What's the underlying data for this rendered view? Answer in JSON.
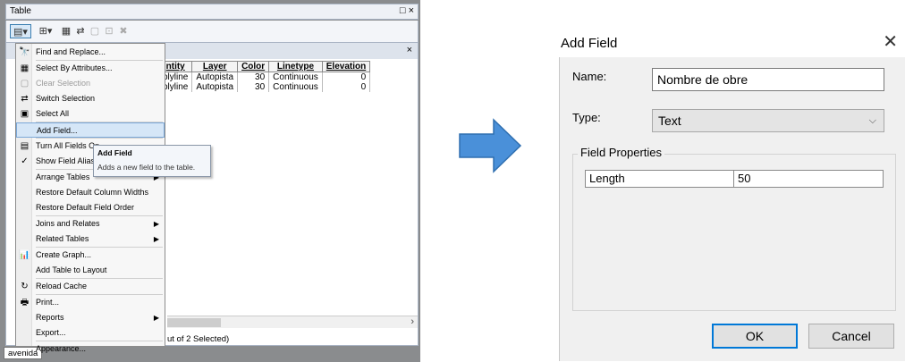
{
  "table_window": {
    "title": "Table",
    "window_buttons": "□ ×",
    "inner_close": "×",
    "columns": [
      "ntity",
      "Layer",
      "Color",
      "Linetype",
      "Elevation"
    ],
    "rows": [
      [
        "olyline",
        "Autopista",
        "30",
        "Continuous",
        "0"
      ],
      [
        "olyline",
        "Autopista",
        "30",
        "Continuous",
        "0"
      ]
    ],
    "status_text": "ut of 2 Selected)",
    "bottom_tab": "avenida",
    "scroll_right_arrow": "›"
  },
  "context_menu": {
    "items": [
      {
        "label": "Find and Replace...",
        "icon": "binoculars-icon",
        "glyph": "🔭"
      },
      {
        "label": "Select By Attributes...",
        "icon": "select-attributes-icon",
        "glyph": "▦"
      },
      {
        "label": "Clear Selection",
        "icon": "clear-selection-icon",
        "glyph": "▢",
        "disabled": true
      },
      {
        "label": "Switch Selection",
        "icon": "switch-selection-icon",
        "glyph": "⇄"
      },
      {
        "label": "Select All",
        "icon": "select-all-icon",
        "glyph": "▣"
      },
      {
        "label": "Add Field...",
        "icon": "",
        "glyph": "",
        "highlight": true
      },
      {
        "label": "Turn All Fields On",
        "icon": "fields-icon",
        "glyph": "▤"
      },
      {
        "label": "Show Field Aliases",
        "icon": "check-icon",
        "glyph": "✓"
      },
      {
        "label": "Arrange Tables",
        "icon": "",
        "glyph": "",
        "submenu": true
      },
      {
        "label": "Restore Default Column Widths",
        "icon": "",
        "glyph": ""
      },
      {
        "label": "Restore Default Field Order",
        "icon": "",
        "glyph": ""
      },
      {
        "label": "Joins and Relates",
        "icon": "",
        "glyph": "",
        "submenu": true
      },
      {
        "label": "Related Tables",
        "icon": "",
        "glyph": "",
        "submenu": true
      },
      {
        "label": "Create Graph...",
        "icon": "graph-icon",
        "glyph": "📊"
      },
      {
        "label": "Add Table to Layout",
        "icon": "",
        "glyph": ""
      },
      {
        "label": "Reload Cache",
        "icon": "reload-icon",
        "glyph": "↻"
      },
      {
        "label": "Print...",
        "icon": "printer-icon",
        "glyph": "🖶"
      },
      {
        "label": "Reports",
        "icon": "",
        "glyph": "",
        "submenu": true
      },
      {
        "label": "Export...",
        "icon": "",
        "glyph": ""
      },
      {
        "label": "Appearance...",
        "icon": "",
        "glyph": ""
      }
    ],
    "submenu_arrow": "▶"
  },
  "tooltip": {
    "title": "Add Field",
    "description": "Adds a new field to the table."
  },
  "dialog": {
    "title": "Add Field",
    "close_glyph": "✕",
    "name_label": "Name:",
    "name_value": "Nombre de obre",
    "type_label": "Type:",
    "type_value": "Text",
    "type_chevron": "⌵",
    "field_properties_label": "Field Properties",
    "property_name": "Length",
    "property_value": "50",
    "ok_label": "OK",
    "cancel_label": "Cancel"
  },
  "colors": {
    "arrow_fill": "#4a90d9",
    "arrow_stroke": "#2f6fb0",
    "ok_border": "#0078d7"
  }
}
